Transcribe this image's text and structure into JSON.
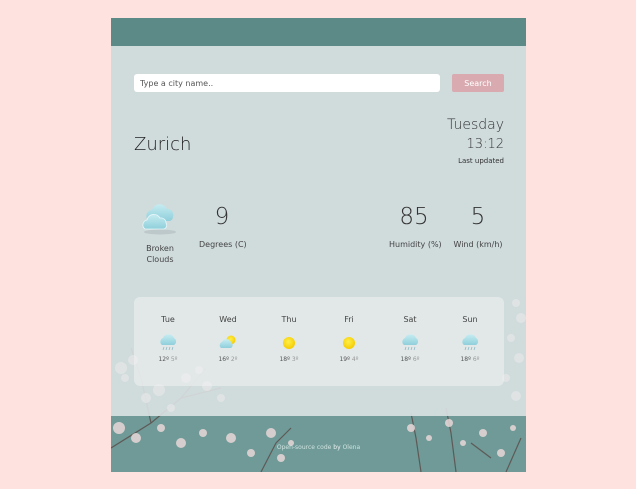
{
  "search": {
    "placeholder": "Type a city name..",
    "button_label": "Search"
  },
  "current": {
    "city": "Zurich",
    "day": "Tuesday",
    "time": "13:12",
    "updated_label": "Last updated",
    "condition": "Broken Clouds",
    "condition_icon": "broken-clouds-icon",
    "temperature": {
      "value": "9",
      "label": "Degrees (C)"
    },
    "humidity": {
      "value": "85",
      "label": "Humidity (%)"
    },
    "wind": {
      "value": "5",
      "label": "Wind (km/h)"
    }
  },
  "forecast": [
    {
      "day": "Tue",
      "icon": "rain-cloud-icon",
      "high": "12º",
      "low": "5º"
    },
    {
      "day": "Wed",
      "icon": "sun-behind-cloud-icon",
      "high": "16º",
      "low": "2º"
    },
    {
      "day": "Thu",
      "icon": "sun-icon",
      "high": "18º",
      "low": "3º"
    },
    {
      "day": "Fri",
      "icon": "sun-icon",
      "high": "19º",
      "low": "4º"
    },
    {
      "day": "Sat",
      "icon": "rain-cloud-icon",
      "high": "18º",
      "low": "6º"
    },
    {
      "day": "Sun",
      "icon": "rain-cloud-icon",
      "high": "18º",
      "low": "6º"
    }
  ],
  "footer": {
    "text": "Open-source code",
    "by": "by",
    "author": "Olena"
  },
  "colors": {
    "page_background": "#fde2df",
    "teal": "#5d8c89",
    "search_button": "#d9aab0",
    "sun": "#ffd400",
    "cloud": "#a8dbe3"
  }
}
